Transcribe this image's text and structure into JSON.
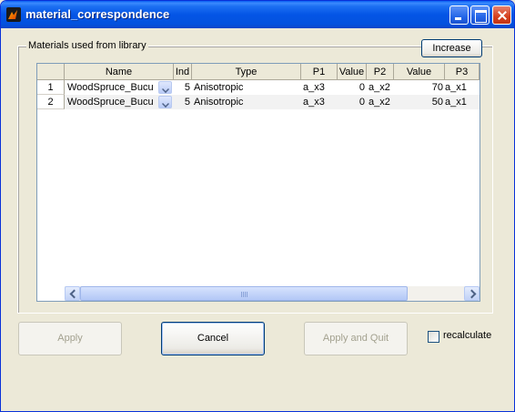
{
  "window": {
    "title": "material_correspondence"
  },
  "group": {
    "label": "Materials used from library"
  },
  "buttons": {
    "increase": "Increase",
    "apply": "Apply",
    "cancel": "Cancel",
    "apply_quit": "Apply and Quit"
  },
  "checkbox": {
    "label": "recalculate",
    "checked": false
  },
  "table": {
    "columns": [
      "Name",
      "Ind",
      "Type",
      "P1",
      "Value",
      "P2",
      "Value",
      "P3"
    ],
    "rows": [
      {
        "num": "1",
        "name": "WoodSpruce_Bucu",
        "ind": "5",
        "type": "Anisotropic",
        "p1": "a_x3",
        "value1": "0",
        "p2": "a_x2",
        "value2": "70",
        "p3": "a_x1"
      },
      {
        "num": "2",
        "name": "WoodSpruce_Bucu",
        "ind": "5",
        "type": "Anisotropic",
        "p1": "a_x3",
        "value1": "0",
        "p2": "a_x2",
        "value2": "50",
        "p3": "a_x1"
      }
    ]
  },
  "icons": [
    "matlab-icon",
    "minimize-icon",
    "maximize-icon",
    "close-icon",
    "chevron-down-icon",
    "scroll-left-icon",
    "scroll-right-icon"
  ]
}
